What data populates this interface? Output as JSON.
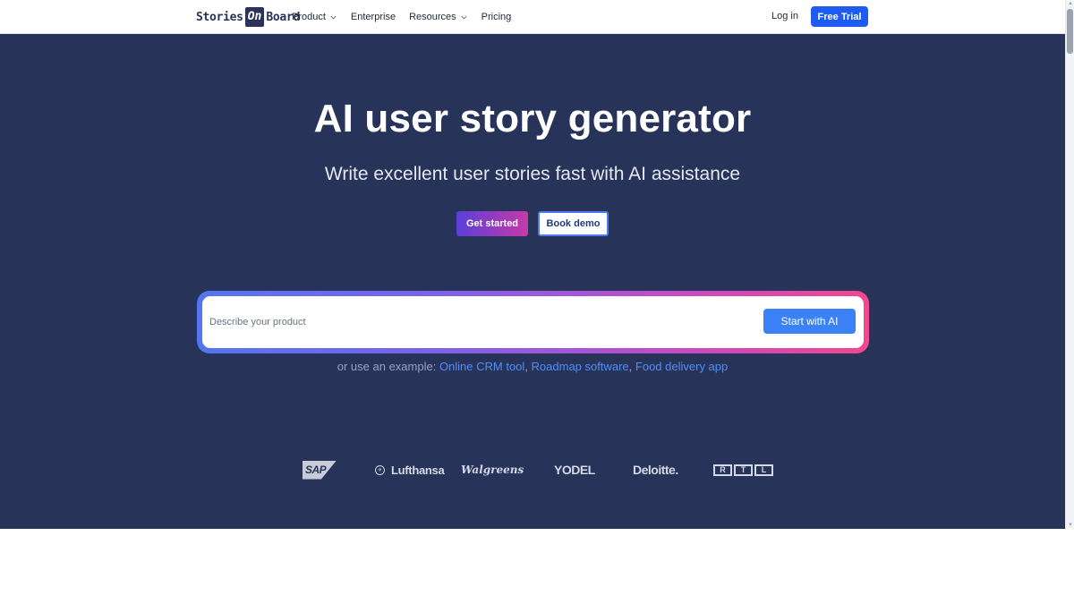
{
  "header": {
    "logo": {
      "part1": "Stories",
      "part2": "On",
      "part3": "Board"
    },
    "nav": [
      {
        "label": "Product",
        "has_dropdown": true
      },
      {
        "label": "Enterprise",
        "has_dropdown": false
      },
      {
        "label": "Resources",
        "has_dropdown": true
      },
      {
        "label": "Pricing",
        "has_dropdown": false
      }
    ],
    "login_label": "Log in",
    "trial_label": "Free Trial"
  },
  "hero": {
    "title": "AI user story generator",
    "subtitle": "Write excellent user stories fast with AI assistance",
    "get_started_label": "Get started",
    "book_demo_label": "Book demo",
    "ai_input": {
      "placeholder": "Describe your product",
      "value": ""
    },
    "ai_button_label": "Start with AI",
    "examples_prefix": "or use an example: ",
    "examples": [
      "Online CRM tool",
      "Roadmap software",
      "Food delivery app"
    ],
    "examples_sep": ", "
  },
  "logos": {
    "sap": "SAP",
    "lufthansa": "Lufthansa",
    "walgreens": "Walgreens",
    "yodel": "YODEL",
    "deloitte": "Deloitte.",
    "rtl": [
      "R",
      "T",
      "L"
    ]
  },
  "colors": {
    "hero_bg": "#28335a",
    "primary": "#1e5bf0",
    "ai_button": "#3b82f6",
    "link": "#4f8ef7",
    "gradient_start": "#5475f0",
    "gradient_end": "#f0488e"
  },
  "icons": {
    "chevron": "chevron-down-icon",
    "lufthansa_crane": "crane-icon"
  }
}
